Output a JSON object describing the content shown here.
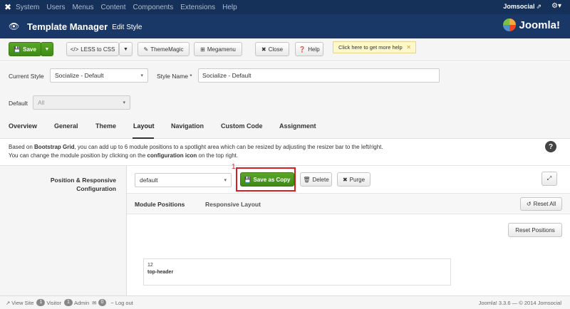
{
  "topnav": {
    "menu": [
      "System",
      "Users",
      "Menus",
      "Content",
      "Components",
      "Extensions",
      "Help"
    ],
    "user": "Jomsocial",
    "user_ext": "⇗",
    "gear": "⚙▾"
  },
  "titlebar": {
    "title": "Template Manager",
    "subtitle": "Edit Style",
    "logo_text": "Joomla!"
  },
  "toolbar": {
    "save": "Save",
    "less_to_css": "LESS to CSS",
    "theme_magic": "ThemeMagic",
    "megamenu": "Megamenu",
    "close": "Close",
    "help": "Help",
    "help_hint": "Click here to get more help",
    "hint_close": "✕"
  },
  "form": {
    "current_style_label": "Current Style",
    "current_style_value": "Socialize - Default",
    "style_name_label": "Style Name *",
    "style_name_value": "Socialize - Default",
    "default_label": "Default",
    "default_value": "All"
  },
  "tabs": [
    "Overview",
    "General",
    "Theme",
    "Layout",
    "Navigation",
    "Custom Code",
    "Assignment"
  ],
  "active_tab": "Layout",
  "info": {
    "p1_pre": "Based on ",
    "p1_bold": "Bootstrap Grid",
    "p1_post": ", you can add up to 6 module positions to a spotlight area which can be resized by adjusting the resizer bar to the left/right.",
    "p2_pre": "You can change the module position by clicking on the ",
    "p2_bold": "configuration icon",
    "p2_post": " on the top right."
  },
  "layout": {
    "label_line1": "Position & Responsive",
    "label_line2": "Configuration",
    "layout_select": "default",
    "save_as_copy": "Save as Copy",
    "delete": "Delete",
    "purge": "Purge",
    "annotation_number": "1",
    "subtabs": [
      "Module Positions",
      "Responsive Layout"
    ],
    "reset_all": "Reset All",
    "reset_positions": "Reset Positions",
    "module": {
      "span": "12",
      "name": "top-header"
    }
  },
  "footer": {
    "view_site": "View Site",
    "visitor_count": "1",
    "visitor_label": "Visitor",
    "admin_count": "1",
    "admin_label": "Admin",
    "mail_count": "0",
    "logout": "Log out",
    "copyright": "Joomla! 3.3.6  —  © 2014 Jomsocial"
  },
  "colors": {
    "topnav_bg": "#15315a",
    "titlebar_bg": "#1a3867",
    "green_button": "#4a9a1e",
    "highlight_red": "#d62020"
  }
}
